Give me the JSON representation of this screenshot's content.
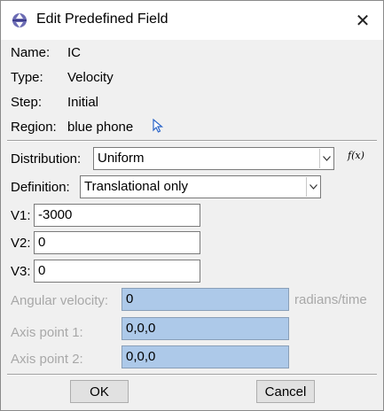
{
  "window": {
    "title": "Edit Predefined Field",
    "close_symbol": "✕"
  },
  "info": {
    "name_label": "Name:",
    "name_value": "IC",
    "type_label": "Type:",
    "type_value": "Velocity",
    "step_label": "Step:",
    "step_value": "Initial",
    "region_label": "Region:",
    "region_value": "blue phone",
    "region_icon": "cursor-arrow-icon"
  },
  "distribution": {
    "label": "Distribution:",
    "value": "Uniform",
    "fx_label": "f(x)"
  },
  "definition": {
    "label": "Definition:",
    "value": "Translational only"
  },
  "velocities": [
    {
      "label": "V1:",
      "value": "-3000"
    },
    {
      "label": "V2:",
      "value": "0"
    },
    {
      "label": "V3:",
      "value": "0"
    }
  ],
  "angular": {
    "label": "Angular velocity:",
    "value": "0",
    "units": "radians/time"
  },
  "axis_point_1": {
    "label": "Axis point 1:",
    "value": "0,0,0"
  },
  "axis_point_2": {
    "label": "Axis point 2:",
    "value": "0,0,0"
  },
  "buttons": {
    "ok": "OK",
    "cancel": "Cancel"
  },
  "colors": {
    "disabled_field": "#adc9e9",
    "disabled_text": "#a8a8a8",
    "accent_icon": "#5a5aa8"
  }
}
